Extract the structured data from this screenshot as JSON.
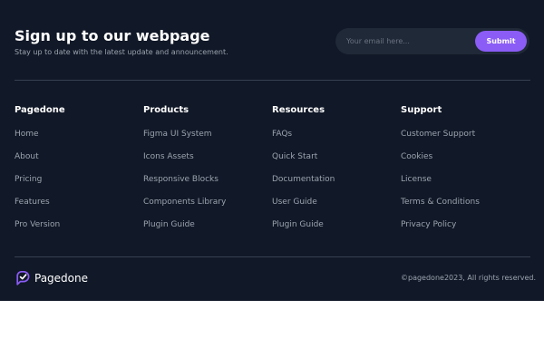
{
  "signup": {
    "heading": "Sign up to our webpage",
    "subtext": "Stay up to date with the latest update and announcement.",
    "email_placeholder": "Your email here...",
    "submit_label": "Submit"
  },
  "columns": [
    {
      "title": "Pagedone",
      "links": [
        "Home",
        "About",
        "Pricing",
        "Features",
        "Pro Version"
      ]
    },
    {
      "title": "Products",
      "links": [
        "Figma UI System",
        "Icons Assets",
        "Responsive Blocks",
        "Components Library",
        "Plugin Guide"
      ]
    },
    {
      "title": "Resources",
      "links": [
        "FAQs",
        "Quick Start",
        "Documentation",
        "User Guide",
        "Plugin Guide"
      ]
    },
    {
      "title": "Support",
      "links": [
        "Customer Support",
        "Cookies",
        "License",
        "Terms & Conditions",
        "Privacy Policy"
      ]
    }
  ],
  "brand": {
    "name": "Pagedone",
    "logo_icon": "speech-bubble-check-icon"
  },
  "copyright": "©pagedone2023, All rights reserved.",
  "colors": {
    "footer_background": "#111827",
    "accent": "#8b5cf6",
    "heading_text": "#ffffff",
    "muted_text": "#9ca3af",
    "input_background": "#1f2937",
    "divider": "#374151",
    "page_background": "#ffffff"
  }
}
